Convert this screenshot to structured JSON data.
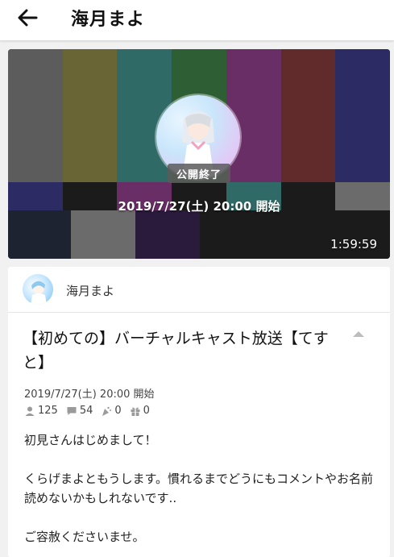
{
  "header": {
    "title": "海月まよ",
    "back_icon": "arrow-left-icon"
  },
  "player": {
    "status_label": "公開終了",
    "start_time": "2019/7/27(土) 20:00  開始",
    "duration": "1:59:59",
    "bar_colors_top": [
      "#5c5c5c",
      "#6a6534",
      "#2f6a66",
      "#2e5e34",
      "#6a2e67",
      "#612a2b",
      "#2c2b63"
    ],
    "bar_colors_mid": [
      "#2c2b63",
      "#1b1b1b",
      "#6a2e67",
      "#1b1b1b",
      "#2f6a66",
      "#1b1b1b",
      "#6b6b6b"
    ],
    "bar_colors_bot": [
      "#1d2330",
      "#6b6b6b",
      "#2a1a3c",
      "#1b1b1b",
      "#1b1b1b",
      "#1b1b1b",
      "#1b1b1b"
    ]
  },
  "post": {
    "host_name": "海月まよ",
    "title": "【初めての】バーチャルキャスト放送【てすと】",
    "date": "2019/7/27(土) 20:00  開始",
    "stats": {
      "viewers": "125",
      "comments": "54",
      "gifts": "0",
      "items": "0"
    },
    "description": [
      "初見さんはじめまして！",
      "くらげまよともうします。慣れるまでどうにもコメントやお名前読めないかもしれないです..",
      "ご容赦くださいませ。"
    ]
  }
}
